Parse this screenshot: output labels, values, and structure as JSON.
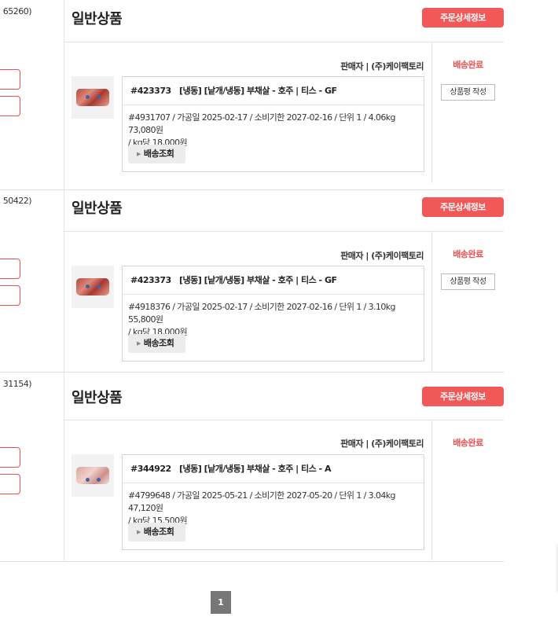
{
  "orders": [
    {
      "order_no_suffix": "65260)",
      "amount_suffix": "원",
      "category": "일반상품",
      "detail_button": "주문상세정보",
      "seller": "판매자 | (주)케이팩토리",
      "status": "배송완료",
      "review_button": "상품평 작성",
      "product_code": "#423373",
      "product_name": "[냉동] [낱개/냉동] 부채살 - 호주 | 티스 - GF",
      "detail_line1": "#4931707 / 가공일 2025-02-17 / 소비기한 2027-02-16 / 단위 1 / 4.06kg 73,080원",
      "detail_line2": "/ kg당 18,000원",
      "tracking_button": "배송조회"
    },
    {
      "order_no_suffix": "50422)",
      "amount_suffix": "원",
      "category": "일반상품",
      "detail_button": "주문상세정보",
      "seller": "판매자 | (주)케이팩토리",
      "status": "배송완료",
      "review_button": "상품평 작성",
      "product_code": "#423373",
      "product_name": "[냉동] [낱개/냉동] 부채살 - 호주 | 티스 - GF",
      "detail_line1": "#4918376 / 가공일 2025-02-17 / 소비기한 2027-02-16 / 단위 1 / 3.10kg 55,800원",
      "detail_line2": "/ kg당 18,000원",
      "tracking_button": "배송조회"
    },
    {
      "order_no_suffix": "31154)",
      "amount_suffix": "원",
      "category": "일반상품",
      "detail_button": "주문상세정보",
      "seller": "판매자 | (주)케이팩토리",
      "status": "배송완료",
      "product_code": "#344922",
      "product_name": "[냉동] [낱개/냉동] 부채살 - 호주 | 티스 - A",
      "detail_line1": "#4799648 / 가공일 2025-05-21 / 소비기한 2027-05-20 / 단위 1 / 3.04kg 47,120원",
      "detail_line2": "/ kg당 15,500원",
      "tracking_button": "배송조회"
    }
  ],
  "pagination": {
    "current_page": "1"
  },
  "colors": {
    "accent": "#f25858",
    "status_text": "#f04f4f"
  }
}
